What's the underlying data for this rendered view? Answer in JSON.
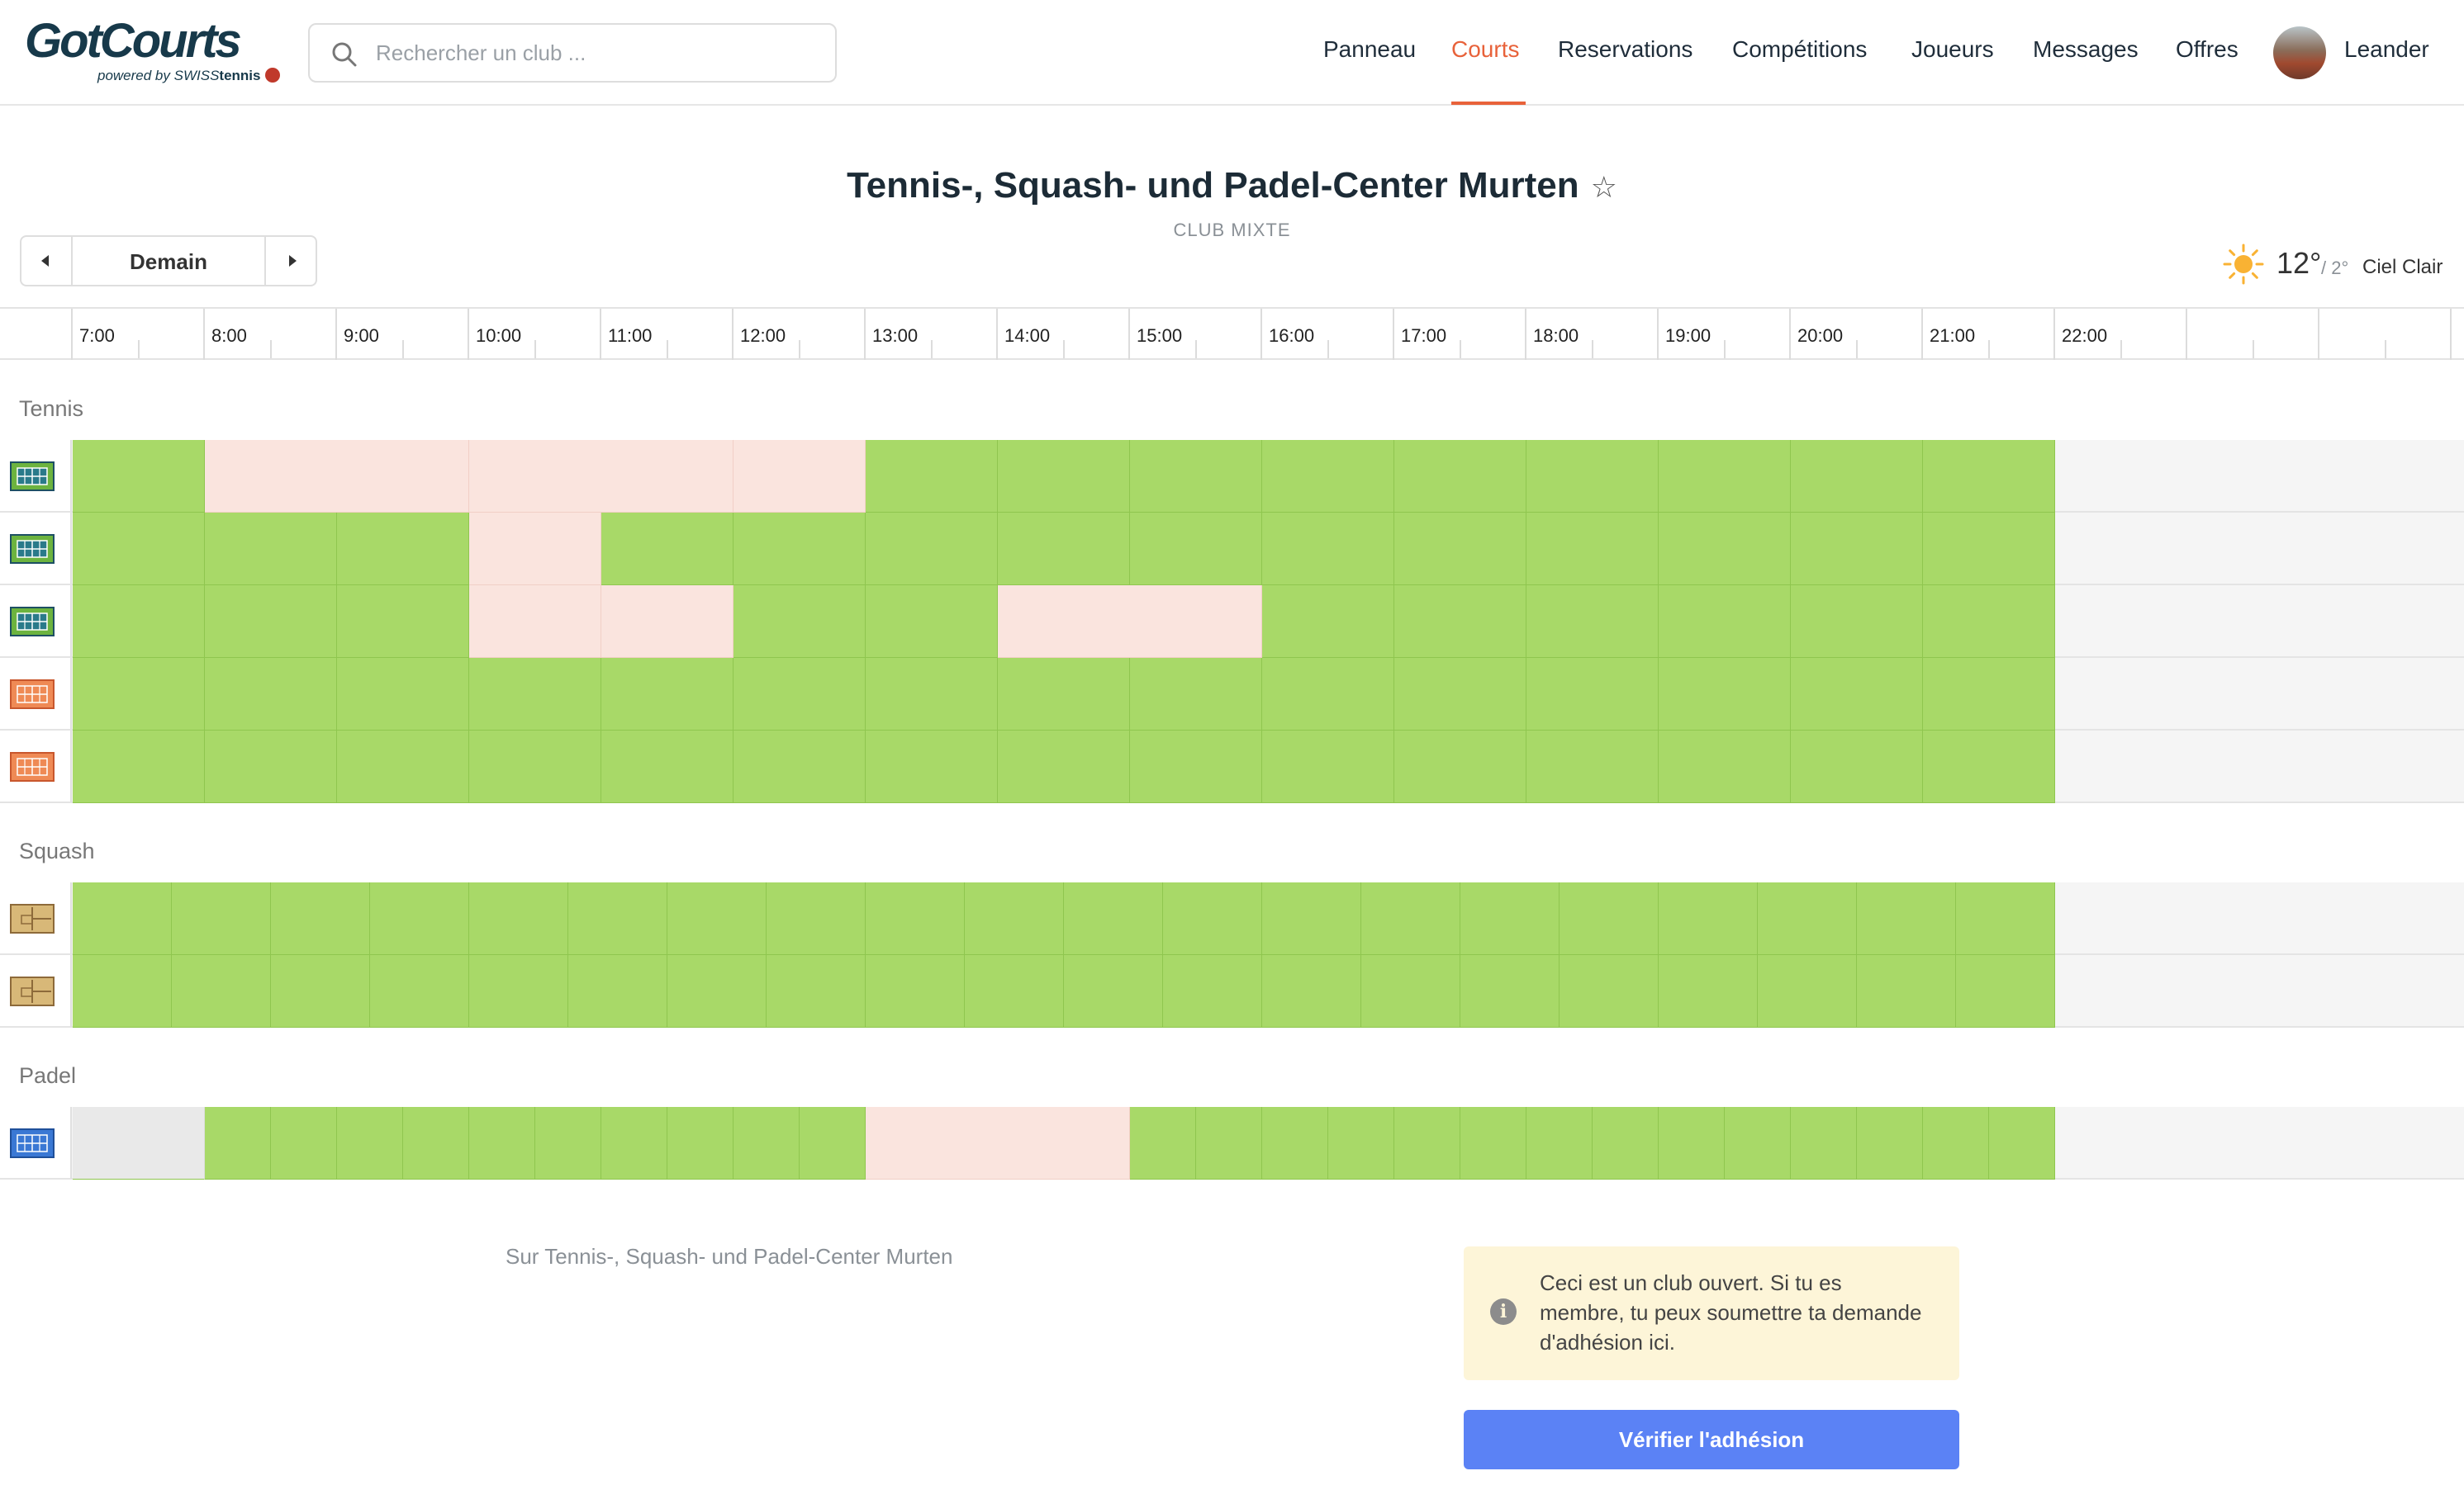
{
  "header": {
    "logo_text": "GotCourts",
    "logo_sub_prefix": "powered by ",
    "logo_sub_brand_a": "SWISS",
    "logo_sub_brand_b": "tennis",
    "search_placeholder": "Rechercher un club ...",
    "nav": [
      {
        "label": "Panneau",
        "active": false
      },
      {
        "label": "Courts",
        "active": true
      },
      {
        "label": "Reservations",
        "active": false
      },
      {
        "label": "Compétitions",
        "active": false
      },
      {
        "label": "Joueurs",
        "active": false
      },
      {
        "label": "Messages",
        "active": false
      },
      {
        "label": "Offres",
        "active": false
      }
    ],
    "user_name": "Leander"
  },
  "club": {
    "title": "Tennis-, Squash- und Padel-Center Murten",
    "star": "☆",
    "type": "CLUB MIXTE"
  },
  "date_selector": {
    "label": "Demain"
  },
  "weather": {
    "temp": "12°",
    "low": "/ 2°",
    "condition": "Ciel Clair",
    "icon": "sun-icon"
  },
  "timeline": {
    "hours": [
      "7:00",
      "8:00",
      "9:00",
      "10:00",
      "11:00",
      "12:00",
      "13:00",
      "14:00",
      "15:00",
      "16:00",
      "17:00",
      "18:00",
      "19:00",
      "20:00",
      "21:00",
      "22:00"
    ]
  },
  "colors": {
    "free": "#a8d968",
    "booked": "#fae4de",
    "closed": "#e9e9e9",
    "accent": "#e8623a",
    "button": "#5b82f5"
  },
  "sections": [
    {
      "name": "Tennis",
      "courts": [
        {
          "icon": "tennis-court-green-icon",
          "booked": [
            [
              8,
              10
            ],
            [
              10,
              12
            ],
            [
              12,
              13
            ]
          ]
        },
        {
          "icon": "tennis-court-green-icon",
          "booked": [
            [
              10,
              11
            ]
          ]
        },
        {
          "icon": "tennis-court-green-icon",
          "booked": [
            [
              10,
              11
            ],
            [
              11,
              12
            ],
            [
              14,
              16
            ]
          ]
        },
        {
          "icon": "tennis-court-orange-icon",
          "booked": []
        },
        {
          "icon": "tennis-court-orange-icon",
          "booked": []
        }
      ]
    },
    {
      "name": "Squash",
      "courts": [
        {
          "icon": "squash-court-icon",
          "booked": []
        },
        {
          "icon": "squash-court-icon",
          "booked": []
        }
      ]
    },
    {
      "name": "Padel",
      "courts": [
        {
          "icon": "padel-court-icon",
          "closed": [
            [
              7,
              8
            ]
          ],
          "booked": [
            [
              13,
              15
            ]
          ]
        }
      ]
    }
  ],
  "footer": {
    "about": "Sur Tennis-, Squash- und Padel-Center Murten",
    "notice": "Ceci est un club ouvert. Si tu es membre, tu peux soumettre ta demande d'adhésion ici.",
    "verify_button": "Vérifier l'adhésion"
  }
}
